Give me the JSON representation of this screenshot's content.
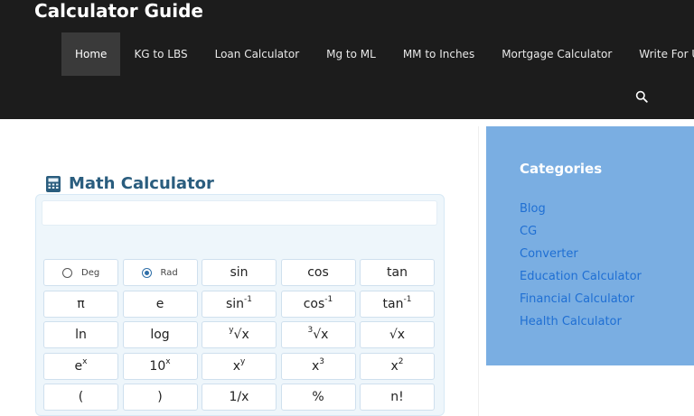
{
  "site": {
    "title": "Calculator Guide"
  },
  "nav": {
    "items": [
      {
        "label": "Home",
        "active": true
      },
      {
        "label": "KG to LBS"
      },
      {
        "label": "Loan Calculator"
      },
      {
        "label": "Mg to ML"
      },
      {
        "label": "MM to Inches"
      },
      {
        "label": "Mortgage Calculator"
      },
      {
        "label": "Write For Us"
      }
    ],
    "search_icon": "search-icon"
  },
  "calculator": {
    "title": "Math Calculator",
    "icon": "calculator-icon",
    "display_value": "",
    "angle_mode": {
      "deg_label": "Deg",
      "rad_label": "Rad",
      "selected": "Rad"
    },
    "keys": {
      "sin": "sin",
      "cos": "cos",
      "tan": "tan",
      "pi": "π",
      "e": "e",
      "asin_base": "sin",
      "acos_base": "cos",
      "atan_base": "tan",
      "inverse_sup": "-1",
      "ln": "ln",
      "log": "log",
      "yroot_pre": "y",
      "yroot_main": "√x",
      "cbrt_pre": "3",
      "cbrt_main": "√x",
      "sqrt": "√x",
      "ex_base": "e",
      "ex_sup": "x",
      "tenx_base": "10",
      "tenx_sup": "x",
      "xy_base": "x",
      "xy_sup": "y",
      "x3_base": "x",
      "x3_sup": "3",
      "x2_base": "x",
      "x2_sup": "2",
      "lparen": "(",
      "rparen": ")",
      "recip": "1/x",
      "percent": "%",
      "factorial": "n!"
    }
  },
  "sidebar": {
    "title": "Categories",
    "items": [
      {
        "label": "Blog"
      },
      {
        "label": "CG"
      },
      {
        "label": "Converter"
      },
      {
        "label": "Education Calculator"
      },
      {
        "label": "Financial Calculator"
      },
      {
        "label": "Health Calculator"
      }
    ]
  },
  "colors": {
    "header_bg": "#1c1c1c",
    "title_blue": "#2a5d7e",
    "sidebar_bg": "#7aaee2",
    "link_blue": "#1f6fd3"
  }
}
